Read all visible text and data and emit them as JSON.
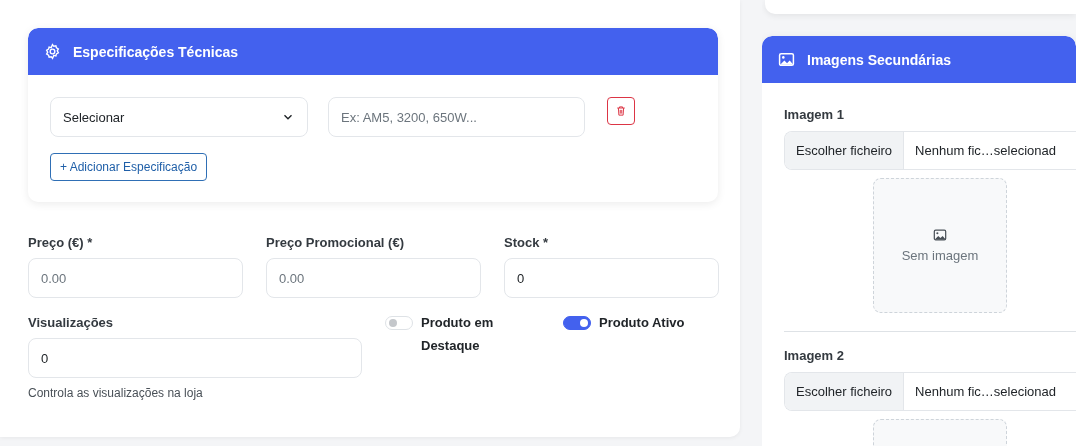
{
  "specifications": {
    "title": "Especificações Técnicas",
    "rows": [
      {
        "select": "Selecionar",
        "value_placeholder": "Ex: AM5, 3200, 650W..."
      }
    ],
    "add_button": "+ Adicionar Especificação"
  },
  "price_fields": [
    {
      "label": "Preço (€) *",
      "placeholder": "0.00"
    },
    {
      "label": "Preço Promocional (€)",
      "placeholder": "0.00"
    },
    {
      "label": "Stock *",
      "value": "0"
    }
  ],
  "views": {
    "label": "Visualizações",
    "value": "0",
    "hint": "Controla as visualizações na loja"
  },
  "toggles": [
    {
      "label": "Produto em Destaque",
      "on": false
    },
    {
      "label": "Produto Ativo",
      "on": true
    }
  ],
  "secondary_images": {
    "title": "Imagens Secundárias",
    "items": [
      {
        "label": "Imagem 1",
        "button": "Escolher ficheiro",
        "file_status": "Nenhum fic…selecionad",
        "preview": "Sem imagem"
      },
      {
        "label": "Imagem 2",
        "button": "Escolher ficheiro",
        "file_status": "Nenhum fic…selecionad"
      }
    ]
  }
}
